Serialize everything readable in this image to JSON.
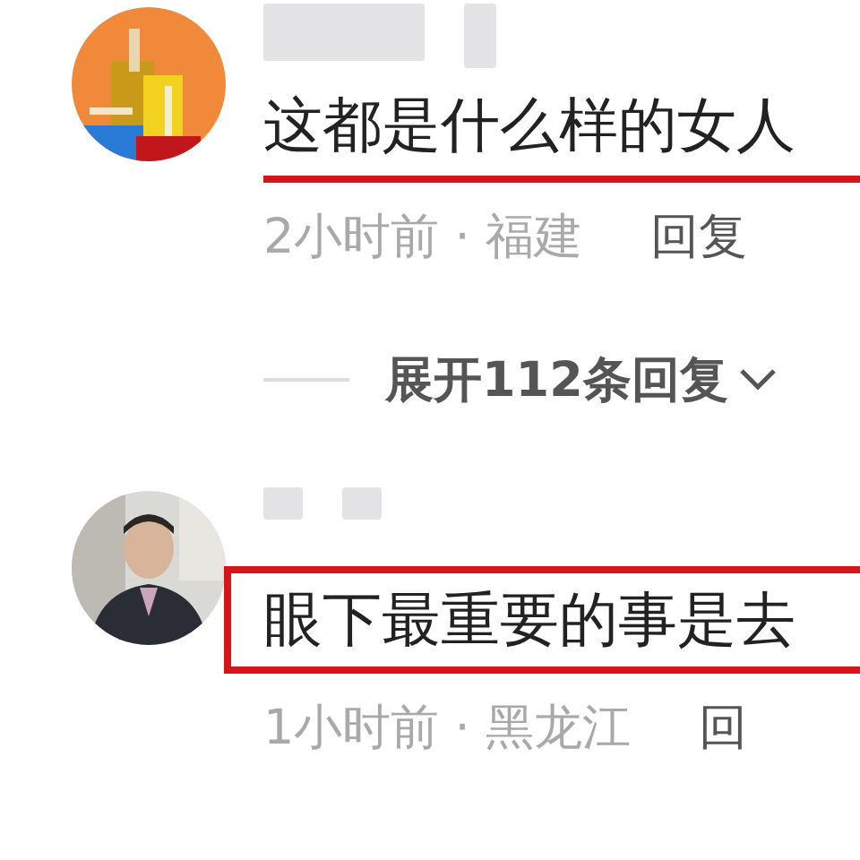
{
  "comments": [
    {
      "text": "这都是什么样的女人",
      "underlined": true,
      "boxed": false,
      "meta": "2小时前 · 福建",
      "reply": "回复",
      "more": {
        "label": "展开112条回复"
      }
    },
    {
      "text": "眼下最重要的事是去",
      "underlined": false,
      "boxed": true,
      "meta": "1小时前 · 黑龙江",
      "reply": "回"
    }
  ]
}
